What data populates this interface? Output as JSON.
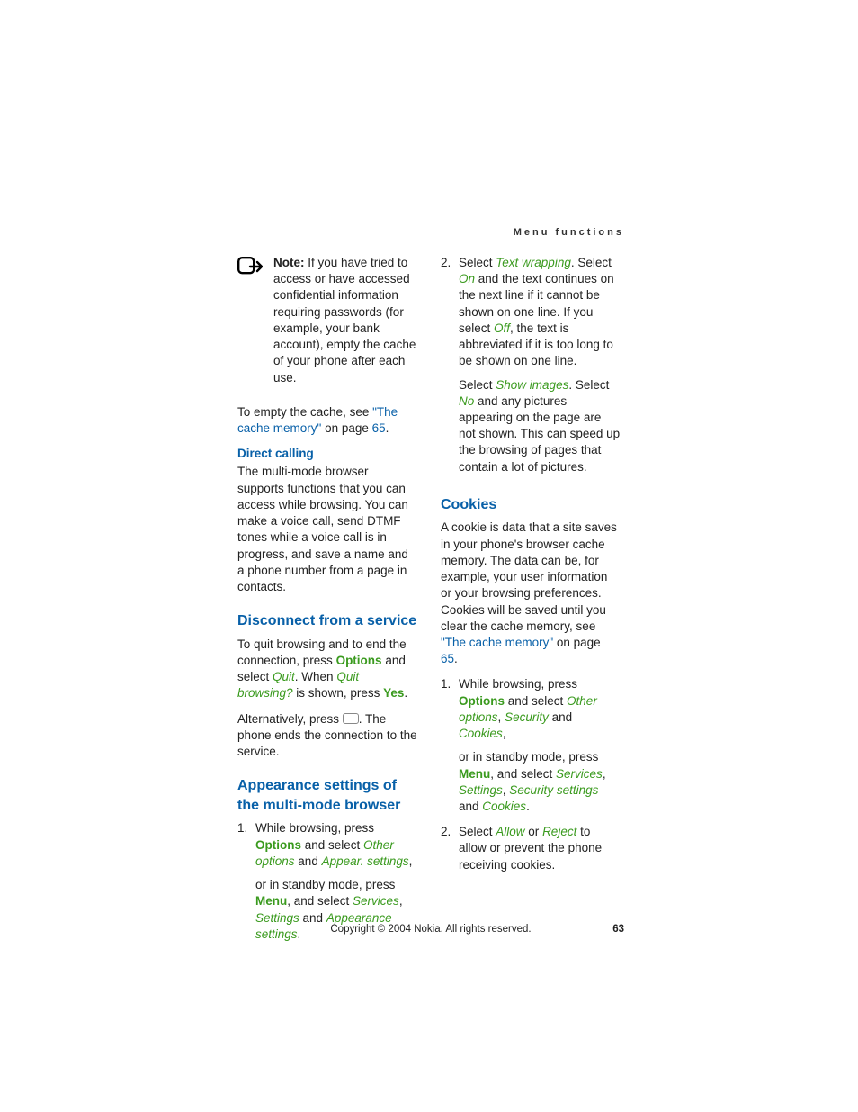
{
  "header": {
    "title": "Menu functions"
  },
  "left": {
    "note": {
      "label": "Note:",
      "text": " If you have tried to access or have accessed confidential information requiring passwords (for example, your bank account), empty the cache of your phone after each use."
    },
    "cache": {
      "a": "To empty the cache, see ",
      "link": "\"The cache memory\"",
      "b": " on page ",
      "page": "65",
      "c": "."
    },
    "direct": {
      "heading": "Direct calling",
      "body": "The multi-mode browser supports functions that you can access while browsing. You can make a voice call, send DTMF tones while a voice call is in progress, and save a name and a phone number from a page in contacts."
    },
    "disconnect": {
      "heading": "Disconnect from a service",
      "p1a": "To quit browsing and to end the connection, press ",
      "options": "Options",
      "p1b": " and select ",
      "quit": "Quit",
      "p1c": ". When ",
      "quitq": "Quit browsing?",
      "p1d": " is shown, press ",
      "yes": "Yes",
      "p1e": ".",
      "p2a": "Alternatively, press ",
      "p2b": ". The phone ends the connection to the service."
    },
    "appearance": {
      "heading": "Appearance settings of the multi-mode browser",
      "s1a": "While browsing, press ",
      "options": "Options",
      "s1b": " and select ",
      "otheropts": "Other options",
      "s1c": " and ",
      "appearset": "Appear. settings",
      "s1d": ",",
      "s1suba": "or in standby mode, press ",
      "menu": "Menu",
      "s1subb": ", and select ",
      "services": "Services",
      "s1subc": ", ",
      "settings": "Settings",
      "s1subd": " and ",
      "appset2": "Appearance settings",
      "s1sube": "."
    }
  },
  "right": {
    "step2": {
      "a": "Select ",
      "textwrap": "Text wrapping",
      "b": ". Select ",
      "on": "On",
      "c": " and the text continues on the next line if it cannot be shown on one line. If you select ",
      "off": "Off",
      "d": ", the text is abbreviated if it is too long to be shown on one line.",
      "suba": "Select ",
      "showimg": "Show images",
      "subb": ". Select ",
      "no": "No",
      "subc": " and any pictures appearing on the page are not shown. This can speed up the browsing of pages that contain a lot of pictures."
    },
    "cookies": {
      "heading": "Cookies",
      "p1a": "A cookie is data that a site saves in your phone's browser cache memory. The data can be, for example, your user information or your browsing preferences. Cookies will be saved until you clear the cache memory, see ",
      "link": "\"The cache memory\"",
      "p1b": " on page ",
      "page": "65",
      "p1c": ".",
      "s1a": "While browsing, press ",
      "options": "Options",
      "s1b": " and select ",
      "otheropts": "Other options",
      "s1c": ", ",
      "security": "Security",
      "s1d": " and ",
      "cookiesw": "Cookies",
      "s1e": ",",
      "s1suba": "or in standby mode, press ",
      "menu": "Menu",
      "s1subb": ", and select ",
      "services": "Services",
      "s1subc": ", ",
      "settings": "Settings",
      "s1subd": ", ",
      "secset": "Security settings",
      "s1sube": " and ",
      "cookiesw2": "Cookies",
      "s1subf": ".",
      "s2a": "Select ",
      "allow": "Allow",
      "s2b": " or ",
      "reject": "Reject",
      "s2c": " to allow or prevent the phone receiving cookies."
    }
  },
  "footer": {
    "copyright": "Copyright © 2004 Nokia. All rights reserved.",
    "page": "63"
  }
}
